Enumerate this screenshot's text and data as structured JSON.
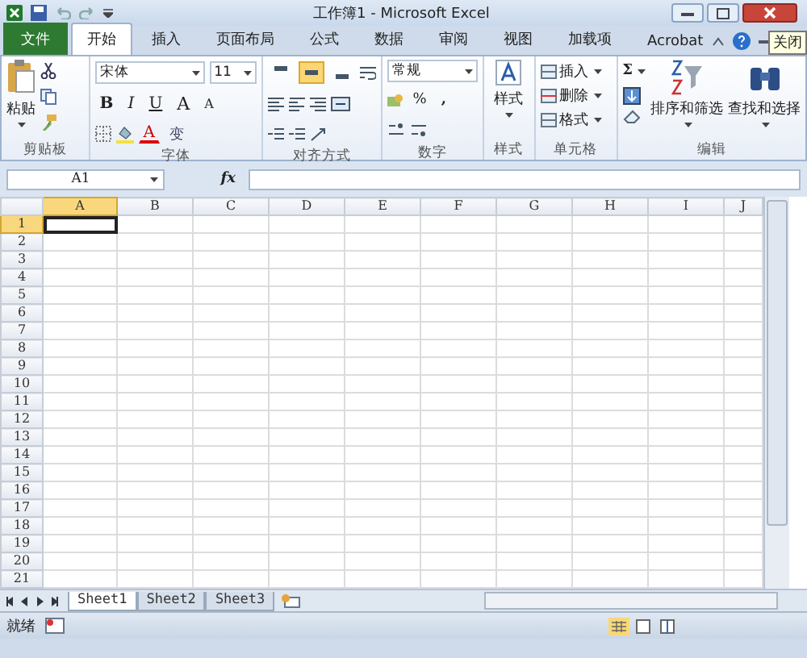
{
  "window": {
    "title": "工作簿1 - Microsoft Excel",
    "close_tooltip": "关闭"
  },
  "tabs": [
    {
      "label": "文件",
      "kind": "file",
      "selected": false
    },
    {
      "label": "开始",
      "kind": "tab",
      "selected": true
    },
    {
      "label": "插入",
      "kind": "tab",
      "selected": false
    },
    {
      "label": "页面布局",
      "kind": "tab",
      "selected": false
    },
    {
      "label": "公式",
      "kind": "tab",
      "selected": false
    },
    {
      "label": "数据",
      "kind": "tab",
      "selected": false
    },
    {
      "label": "审阅",
      "kind": "tab",
      "selected": false
    },
    {
      "label": "视图",
      "kind": "tab",
      "selected": false
    },
    {
      "label": "加载项",
      "kind": "tab",
      "selected": false
    },
    {
      "label": "Acrobat",
      "kind": "tab",
      "selected": false
    }
  ],
  "ribbon": {
    "clipboard": {
      "label": "剪贴板",
      "paste": "粘贴"
    },
    "font": {
      "label": "字体",
      "name": "宋体",
      "size": "11",
      "bold": "B",
      "italic": "I",
      "underline": "U",
      "grow": "A",
      "shrink": "A",
      "font_color": "A",
      "phonetic": "变"
    },
    "alignment": {
      "label": "对齐方式",
      "top_buttons": [
        {
          "selected": false
        },
        {
          "selected": true
        },
        {
          "selected": false
        }
      ]
    },
    "number": {
      "label": "数字",
      "format": "常规",
      "percent": "%",
      "comma": ","
    },
    "styles": {
      "label": "样式",
      "button": "样式"
    },
    "cells": {
      "label": "单元格",
      "items": [
        "插入",
        "删除",
        "格式"
      ]
    },
    "editing": {
      "label": "编辑",
      "sum": "Σ",
      "sort": "排序和筛选",
      "find": "查找和选择"
    }
  },
  "formula_bar": {
    "name_box": "A1",
    "fx": "fx"
  },
  "sheet": {
    "columns": [
      {
        "label": "A",
        "selected": true
      },
      {
        "label": "B",
        "selected": false
      },
      {
        "label": "C",
        "selected": false
      },
      {
        "label": "D",
        "selected": false
      },
      {
        "label": "E",
        "selected": false
      },
      {
        "label": "F",
        "selected": false
      },
      {
        "label": "G",
        "selected": false
      },
      {
        "label": "H",
        "selected": false
      },
      {
        "label": "I",
        "selected": false
      },
      {
        "label": "J",
        "selected": false
      }
    ],
    "rows": [
      {
        "label": "1",
        "selected": true
      },
      {
        "label": "2",
        "selected": false
      },
      {
        "label": "3",
        "selected": false
      },
      {
        "label": "4",
        "selected": false
      },
      {
        "label": "5",
        "selected": false
      },
      {
        "label": "6",
        "selected": false
      },
      {
        "label": "7",
        "selected": false
      },
      {
        "label": "8",
        "selected": false
      },
      {
        "label": "9",
        "selected": false
      },
      {
        "label": "10",
        "selected": false
      },
      {
        "label": "11",
        "selected": false
      },
      {
        "label": "12",
        "selected": false
      },
      {
        "label": "13",
        "selected": false
      },
      {
        "label": "14",
        "selected": false
      },
      {
        "label": "15",
        "selected": false
      },
      {
        "label": "16",
        "selected": false
      },
      {
        "label": "17",
        "selected": false
      },
      {
        "label": "18",
        "selected": false
      },
      {
        "label": "19",
        "selected": false
      },
      {
        "label": "20",
        "selected": false
      },
      {
        "label": "21",
        "selected": false
      }
    ]
  },
  "sheet_tabs": [
    {
      "label": "Sheet1",
      "selected": true
    },
    {
      "label": "Sheet2",
      "selected": false
    },
    {
      "label": "Sheet3",
      "selected": false
    }
  ],
  "status_bar": {
    "text": "就绪"
  }
}
